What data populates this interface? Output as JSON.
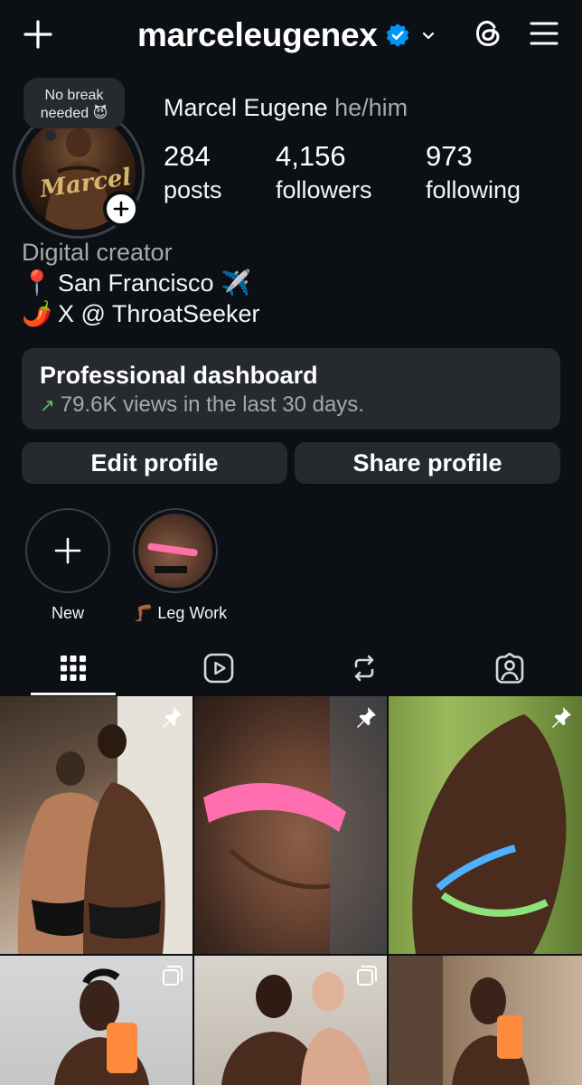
{
  "header": {
    "username": "marceleugenex",
    "icons": [
      "plus-icon",
      "verified-badge-icon",
      "chevron-down-icon",
      "threads-icon",
      "menu-icon"
    ]
  },
  "profile": {
    "note_line1": "No break",
    "note_line2": "needed 😈",
    "avatar_text": "Marcel",
    "full_name": "Marcel Eugene",
    "pronouns": "he/him",
    "stats": {
      "posts_count": "284",
      "posts_label": "posts",
      "followers_count": "4,156",
      "followers_label": "followers",
      "following_count": "973",
      "following_label": "following"
    },
    "bio": {
      "category": "Digital creator",
      "location_emoji": "📍",
      "location": "San Francisco ✈️",
      "link_emoji": "🌶️",
      "link": "X @ ThroatSeeker"
    }
  },
  "dashboard": {
    "title": "Professional dashboard",
    "subtitle": "79.6K views in the last 30 days."
  },
  "actions": {
    "edit_label": "Edit profile",
    "share_label": "Share profile"
  },
  "highlights": [
    {
      "label": "New"
    },
    {
      "label": "🦵🏾 Leg Work"
    }
  ],
  "tabs": [
    "grid-icon",
    "reels-icon",
    "reposts-icon",
    "tagged-icon"
  ],
  "colors": {
    "background": "#0c1014",
    "card": "#262a2f",
    "verified": "#0095f6",
    "trend_up": "#5ec269"
  }
}
